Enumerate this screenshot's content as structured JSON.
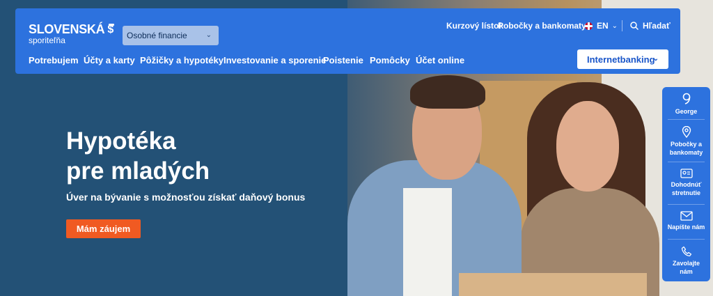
{
  "brand": {
    "name": "SLOVENSKÁ",
    "sub": "sporiteľňa"
  },
  "segment_select": {
    "value": "Osobné financie"
  },
  "top_links": [
    "Kurzový lístok",
    "Pobočky a bankomaty"
  ],
  "language": {
    "code": "EN",
    "flag_icon": "uk-flag-icon"
  },
  "search": {
    "label": "Hľadať"
  },
  "nav": {
    "items": [
      "Potrebujem",
      "Účty a karty",
      "Pôžičky a hypotéky",
      "Investovanie a sporenie",
      "Poistenie",
      "Pomôcky",
      "Účet online"
    ]
  },
  "internetbanking_button": {
    "label": "Internetbanking"
  },
  "hero": {
    "title_line1": "Hypotéka",
    "title_line2": "pre mladých",
    "subtitle": "Úver na bývanie s možnosťou získať daňový bonus",
    "cta": "Mám záujem"
  },
  "quick_panel": {
    "items": [
      {
        "icon": "george-icon",
        "label": "George"
      },
      {
        "icon": "location-pin-icon",
        "label": "Pobočky a bankomaty"
      },
      {
        "icon": "id-card-icon",
        "label": "Dohodnúť stretnutie"
      },
      {
        "icon": "envelope-icon",
        "label": "Napíšte nám"
      },
      {
        "icon": "phone-icon",
        "label": "Zavolajte nám"
      }
    ]
  },
  "colors": {
    "header": "#2d72de",
    "background": "#235176",
    "cta": "#f05a22"
  }
}
